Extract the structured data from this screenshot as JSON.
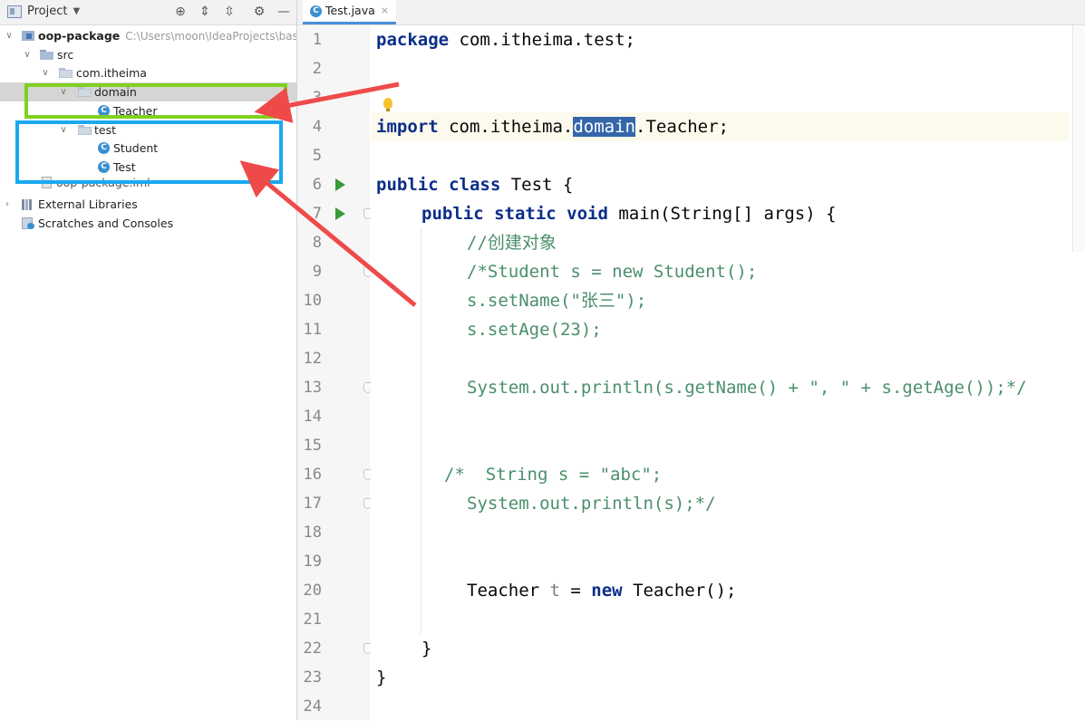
{
  "project": {
    "title": "Project",
    "tree": [
      {
        "label": "oop-package",
        "path": "C:\\Users\\moon\\IdeaProjects\\bas",
        "icon": "module-icon"
      },
      {
        "label": "src",
        "icon": "folder-icon"
      },
      {
        "label": "com.itheima",
        "icon": "package-icon"
      },
      {
        "label": "domain",
        "icon": "package-icon"
      },
      {
        "label": "Teacher",
        "icon": "class-icon"
      },
      {
        "label": "test",
        "icon": "package-icon"
      },
      {
        "label": "Student",
        "icon": "class-icon"
      },
      {
        "label": "Test",
        "icon": "class-icon"
      },
      {
        "label": "oop-package.iml",
        "icon": "file-icon"
      },
      {
        "label": "External Libraries",
        "icon": "library-icon"
      },
      {
        "label": "Scratches and Consoles",
        "icon": "scratch-icon"
      }
    ]
  },
  "editor": {
    "tab_label": "Test.java",
    "line_numbers": [
      "1",
      "2",
      "3",
      "4",
      "5",
      "6",
      "7",
      "8",
      "9",
      "10",
      "11",
      "12",
      "13",
      "14",
      "15",
      "16",
      "17",
      "18",
      "19",
      "20",
      "21",
      "22",
      "23",
      "24"
    ],
    "code": {
      "l1_kw": "package",
      "l1_rest": " com.itheima.test;",
      "l4_kw": "import",
      "l4_a": " com.itheima.",
      "l4_hl": "domain",
      "l4_b": ".Teacher;",
      "l6_kw": "public class",
      "l6_rest": " Test {",
      "l7_kw": "public static void",
      "l7_rest": " main(String[] args) {",
      "l8": "//创建对象",
      "l9": "/*Student s = new Student();",
      "l10": "s.setName(\"张三\");",
      "l11": "s.setAge(23);",
      "l13": "System.out.println(s.getName() + \", \" + s.getAge());*/",
      "l16": "/*  String s = \"abc\";",
      "l17": "System.out.println(s);*/",
      "l20_a": "Teacher ",
      "l20_t": "t",
      "l20_b": " = ",
      "l20_kw": "new",
      "l20_c": " Teacher();",
      "l22": "}",
      "l23": "}"
    }
  },
  "colors": {
    "green_box": "#80d020",
    "blue_box": "#1aa8f0",
    "arrow": "#ef4a4a"
  }
}
